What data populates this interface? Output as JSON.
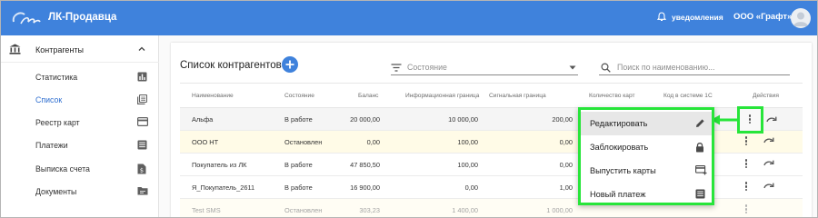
{
  "header": {
    "app_title": "ЛК-Продавца",
    "notifications_label": "уведомления",
    "org_name": "ООО «Графт»",
    "color": "#3f82dc"
  },
  "sidebar": {
    "group_label": "Контрагенты",
    "items": [
      {
        "label": "Статистика",
        "icon": "bar-chart-icon"
      },
      {
        "label": "Список",
        "icon": "list-pages-icon",
        "active": true
      },
      {
        "label": "Реестр карт",
        "icon": "credit-card-icon"
      },
      {
        "label": "Платежи",
        "icon": "document-lines-icon"
      },
      {
        "label": "Выписка счета",
        "icon": "money-file-icon"
      },
      {
        "label": "Документы",
        "icon": "folder-icon"
      }
    ]
  },
  "main": {
    "title": "Список контрагентов",
    "status_placeholder": "Состояние",
    "search_placeholder": "Поиск по наименованию...",
    "columns": [
      "Наименование",
      "Состояние",
      "Баланс",
      "Информационная граница",
      "Сигнальная граница",
      "Количество карт",
      "Код в системе 1С",
      "Действия"
    ],
    "rows": [
      {
        "name": "Альфа",
        "state": "В работе",
        "balance": "20 000,00",
        "info": "10 000,00",
        "signal": "200,00"
      },
      {
        "name": "ООО НТ",
        "state": "Остановлен",
        "balance": "0,00",
        "info": "100,00",
        "signal": "0,00"
      },
      {
        "name": "Покупатель из ЛК",
        "state": "В работе",
        "balance": "47 850,50",
        "info": "100,00",
        "signal": "0,00"
      },
      {
        "name": "Я_Покупатель_2611",
        "state": "В работе",
        "balance": "16 900,00",
        "info": "0,00",
        "signal": "1,00"
      },
      {
        "name": "Test SMS",
        "state": "Остановлен",
        "balance": "303,23",
        "info": "1 400,00",
        "signal": "1 000,00"
      }
    ]
  },
  "menu": {
    "items": [
      {
        "label": "Редактировать",
        "icon": "pencil-icon"
      },
      {
        "label": "Заблокировать",
        "icon": "lock-icon"
      },
      {
        "label": "Выпустить карты",
        "icon": "card-plus-icon"
      },
      {
        "label": "Новый платеж",
        "icon": "document-lines-icon"
      }
    ],
    "highlight_color": "#27e53a"
  }
}
